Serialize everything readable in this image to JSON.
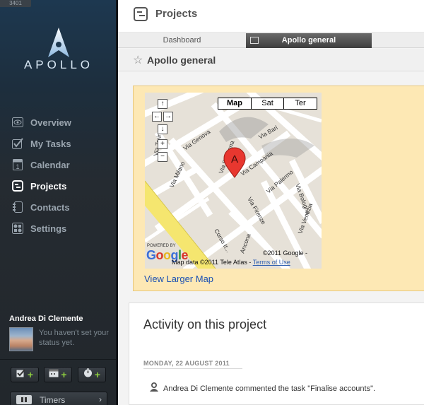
{
  "build": "3401",
  "app": {
    "logo_text": "APOLLO"
  },
  "sidebar": {
    "items": [
      {
        "label": "Overview",
        "active": false
      },
      {
        "label": "My Tasks",
        "active": false
      },
      {
        "label": "Calendar",
        "active": false,
        "calendar_day": "1"
      },
      {
        "label": "Projects",
        "active": true
      },
      {
        "label": "Contacts",
        "active": false
      },
      {
        "label": "Settings",
        "active": false
      }
    ],
    "user": {
      "name": "Andrea Di Clemente",
      "status": "You haven't set your status yet."
    },
    "quick_add": {
      "plus": "+"
    },
    "timers": {
      "label": "Timers",
      "chevron": "›"
    }
  },
  "header": {
    "title": "Projects"
  },
  "tabs": [
    {
      "label": "Dashboard",
      "active": false
    },
    {
      "label": "Apollo general",
      "active": true
    }
  ],
  "subheader": {
    "star": "☆",
    "title": "Apollo general"
  },
  "map": {
    "types": [
      "Map",
      "Sat",
      "Ter"
    ],
    "selected_type": "Map",
    "marker_label": "A",
    "streets": [
      "Via Genova",
      "Via Ravenna",
      "Via Bari",
      "Via Campania",
      "Via Milano",
      "Via Torino",
      "Via Palermo",
      "Via Bologna",
      "Via Firenze",
      "Via Venezia",
      "Ancona",
      "Corso It..."
    ],
    "controls": {
      "up": "↑",
      "down": "↓",
      "left": "←",
      "right": "→",
      "zoom_in": "+",
      "zoom_out": "−"
    },
    "powered_by": "POWERED BY",
    "google": "Google",
    "copyright_1": "©2011 Google -",
    "copyright_2": "Map data ©2011 Tele Atlas -",
    "terms": "Terms of Use",
    "larger_link": "View Larger Map"
  },
  "activity": {
    "title": "Activity on this project",
    "date": "MONDAY, 22 AUGUST 2011",
    "entries": [
      {
        "text": "Andrea Di Clemente commented the task \"Finalise accounts\"."
      }
    ]
  },
  "colors": {
    "sidebar": "#22272c",
    "accent_green": "#8fd13f",
    "map_panel": "#fde8b4",
    "link": "#1a4fb3",
    "marker": "#e8372f"
  }
}
